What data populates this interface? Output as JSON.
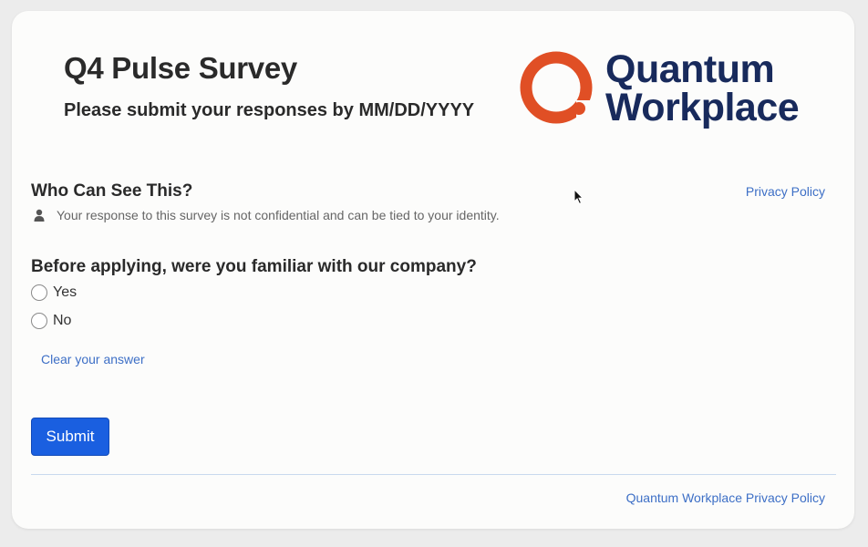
{
  "header": {
    "title": "Q4 Pulse Survey",
    "subtitle": "Please submit your responses by MM/DD/YYYY"
  },
  "logo": {
    "line1": "Quantum",
    "line2": "Workplace",
    "ring_color": "#e04f25",
    "text_color": "#182a5c"
  },
  "visibility": {
    "heading": "Who Can See This?",
    "privacy_link": "Privacy Policy",
    "icon": "person-icon",
    "notice": "Your response to this survey is not confidential and can be tied to your identity."
  },
  "question": {
    "text": "Before applying, were you familiar with our company?",
    "options": [
      "Yes",
      "No"
    ],
    "selected": null,
    "clear_label": "Clear your answer"
  },
  "actions": {
    "submit_label": "Submit",
    "accent": "#1a5fe0"
  },
  "footer": {
    "privacy_link": "Quantum Workplace Privacy Policy",
    "link_color": "#3d6fc6"
  }
}
